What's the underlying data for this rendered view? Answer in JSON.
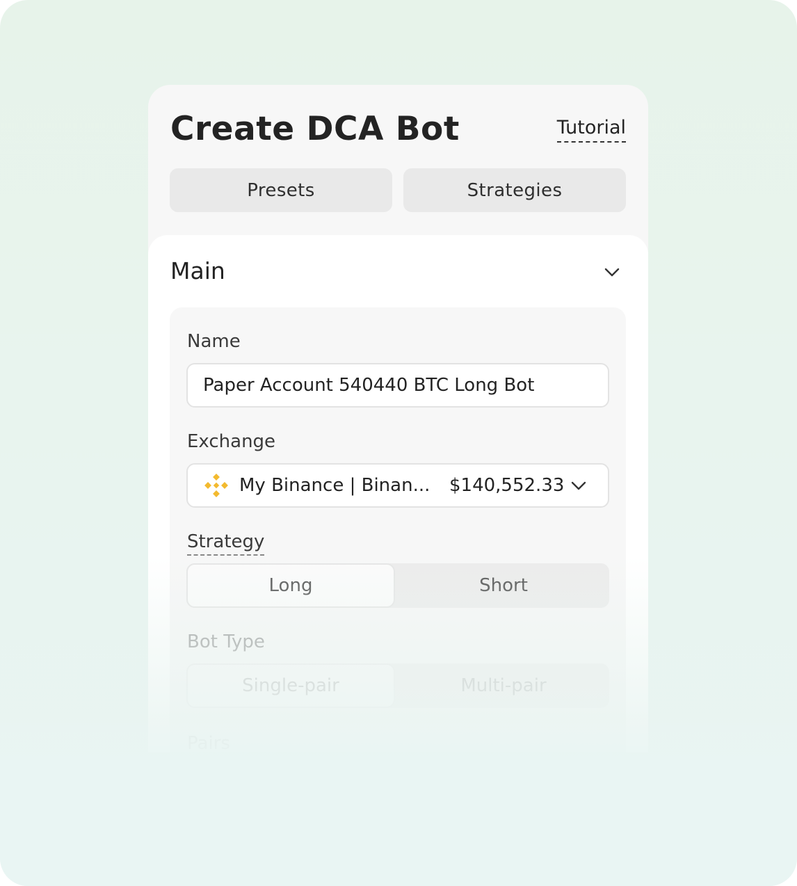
{
  "header": {
    "title": "Create DCA Bot",
    "tutorial_label": "Tutorial",
    "presets_label": "Presets",
    "strategies_label": "Strategies"
  },
  "main": {
    "section_title": "Main",
    "name": {
      "label": "Name",
      "value": "Paper Account 540440 BTC Long Bot"
    },
    "exchange": {
      "label": "Exchange",
      "icon": "binance-icon",
      "name": "My Binance | Binan...",
      "balance": "$140,552.33"
    },
    "strategy": {
      "label": "Strategy",
      "options": [
        "Long",
        "Short"
      ],
      "selected": "Long"
    },
    "bot_type": {
      "label": "Bot Type",
      "options": [
        "Single-pair",
        "Multi-pair"
      ],
      "selected": "Single-pair"
    },
    "pairs": {
      "label": "Pairs"
    }
  },
  "colors": {
    "binance_yellow": "#F3BA2F",
    "background": "#E8F4EE"
  }
}
